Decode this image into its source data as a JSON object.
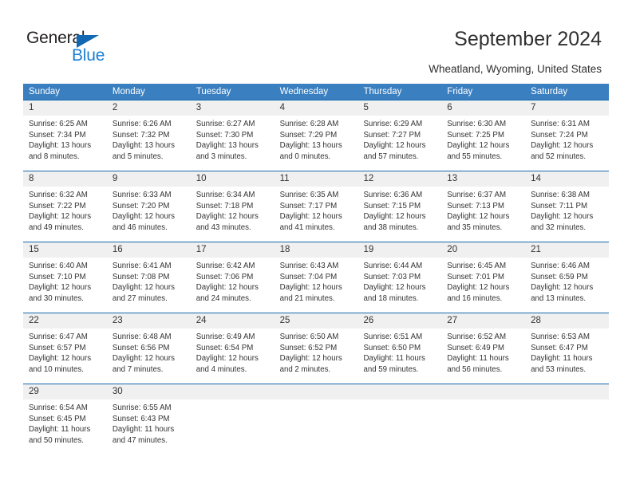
{
  "logo": {
    "primary_text": "General",
    "secondary_text": "Blue",
    "flag_icon": "blue-triangle-flag",
    "primary_color": "#231f20",
    "secondary_color": "#1a7fd4"
  },
  "header": {
    "title": "September 2024",
    "subtitle": "Wheatland, Wyoming, United States"
  },
  "theme": {
    "header_bar_color": "#3a7fc0",
    "cell_top_border_color": "#1668ae",
    "daynum_band_color": "#f0f0f0",
    "text_color": "#333333"
  },
  "calendar": {
    "weekdays": [
      "Sunday",
      "Monday",
      "Tuesday",
      "Wednesday",
      "Thursday",
      "Friday",
      "Saturday"
    ],
    "weeks": [
      [
        {
          "day": "1",
          "sunrise": "Sunrise: 6:25 AM",
          "sunset": "Sunset: 7:34 PM",
          "daylight": "Daylight: 13 hours and 8 minutes."
        },
        {
          "day": "2",
          "sunrise": "Sunrise: 6:26 AM",
          "sunset": "Sunset: 7:32 PM",
          "daylight": "Daylight: 13 hours and 5 minutes."
        },
        {
          "day": "3",
          "sunrise": "Sunrise: 6:27 AM",
          "sunset": "Sunset: 7:30 PM",
          "daylight": "Daylight: 13 hours and 3 minutes."
        },
        {
          "day": "4",
          "sunrise": "Sunrise: 6:28 AM",
          "sunset": "Sunset: 7:29 PM",
          "daylight": "Daylight: 13 hours and 0 minutes."
        },
        {
          "day": "5",
          "sunrise": "Sunrise: 6:29 AM",
          "sunset": "Sunset: 7:27 PM",
          "daylight": "Daylight: 12 hours and 57 minutes."
        },
        {
          "day": "6",
          "sunrise": "Sunrise: 6:30 AM",
          "sunset": "Sunset: 7:25 PM",
          "daylight": "Daylight: 12 hours and 55 minutes."
        },
        {
          "day": "7",
          "sunrise": "Sunrise: 6:31 AM",
          "sunset": "Sunset: 7:24 PM",
          "daylight": "Daylight: 12 hours and 52 minutes."
        }
      ],
      [
        {
          "day": "8",
          "sunrise": "Sunrise: 6:32 AM",
          "sunset": "Sunset: 7:22 PM",
          "daylight": "Daylight: 12 hours and 49 minutes."
        },
        {
          "day": "9",
          "sunrise": "Sunrise: 6:33 AM",
          "sunset": "Sunset: 7:20 PM",
          "daylight": "Daylight: 12 hours and 46 minutes."
        },
        {
          "day": "10",
          "sunrise": "Sunrise: 6:34 AM",
          "sunset": "Sunset: 7:18 PM",
          "daylight": "Daylight: 12 hours and 43 minutes."
        },
        {
          "day": "11",
          "sunrise": "Sunrise: 6:35 AM",
          "sunset": "Sunset: 7:17 PM",
          "daylight": "Daylight: 12 hours and 41 minutes."
        },
        {
          "day": "12",
          "sunrise": "Sunrise: 6:36 AM",
          "sunset": "Sunset: 7:15 PM",
          "daylight": "Daylight: 12 hours and 38 minutes."
        },
        {
          "day": "13",
          "sunrise": "Sunrise: 6:37 AM",
          "sunset": "Sunset: 7:13 PM",
          "daylight": "Daylight: 12 hours and 35 minutes."
        },
        {
          "day": "14",
          "sunrise": "Sunrise: 6:38 AM",
          "sunset": "Sunset: 7:11 PM",
          "daylight": "Daylight: 12 hours and 32 minutes."
        }
      ],
      [
        {
          "day": "15",
          "sunrise": "Sunrise: 6:40 AM",
          "sunset": "Sunset: 7:10 PM",
          "daylight": "Daylight: 12 hours and 30 minutes."
        },
        {
          "day": "16",
          "sunrise": "Sunrise: 6:41 AM",
          "sunset": "Sunset: 7:08 PM",
          "daylight": "Daylight: 12 hours and 27 minutes."
        },
        {
          "day": "17",
          "sunrise": "Sunrise: 6:42 AM",
          "sunset": "Sunset: 7:06 PM",
          "daylight": "Daylight: 12 hours and 24 minutes."
        },
        {
          "day": "18",
          "sunrise": "Sunrise: 6:43 AM",
          "sunset": "Sunset: 7:04 PM",
          "daylight": "Daylight: 12 hours and 21 minutes."
        },
        {
          "day": "19",
          "sunrise": "Sunrise: 6:44 AM",
          "sunset": "Sunset: 7:03 PM",
          "daylight": "Daylight: 12 hours and 18 minutes."
        },
        {
          "day": "20",
          "sunrise": "Sunrise: 6:45 AM",
          "sunset": "Sunset: 7:01 PM",
          "daylight": "Daylight: 12 hours and 16 minutes."
        },
        {
          "day": "21",
          "sunrise": "Sunrise: 6:46 AM",
          "sunset": "Sunset: 6:59 PM",
          "daylight": "Daylight: 12 hours and 13 minutes."
        }
      ],
      [
        {
          "day": "22",
          "sunrise": "Sunrise: 6:47 AM",
          "sunset": "Sunset: 6:57 PM",
          "daylight": "Daylight: 12 hours and 10 minutes."
        },
        {
          "day": "23",
          "sunrise": "Sunrise: 6:48 AM",
          "sunset": "Sunset: 6:56 PM",
          "daylight": "Daylight: 12 hours and 7 minutes."
        },
        {
          "day": "24",
          "sunrise": "Sunrise: 6:49 AM",
          "sunset": "Sunset: 6:54 PM",
          "daylight": "Daylight: 12 hours and 4 minutes."
        },
        {
          "day": "25",
          "sunrise": "Sunrise: 6:50 AM",
          "sunset": "Sunset: 6:52 PM",
          "daylight": "Daylight: 12 hours and 2 minutes."
        },
        {
          "day": "26",
          "sunrise": "Sunrise: 6:51 AM",
          "sunset": "Sunset: 6:50 PM",
          "daylight": "Daylight: 11 hours and 59 minutes."
        },
        {
          "day": "27",
          "sunrise": "Sunrise: 6:52 AM",
          "sunset": "Sunset: 6:49 PM",
          "daylight": "Daylight: 11 hours and 56 minutes."
        },
        {
          "day": "28",
          "sunrise": "Sunrise: 6:53 AM",
          "sunset": "Sunset: 6:47 PM",
          "daylight": "Daylight: 11 hours and 53 minutes."
        }
      ],
      [
        {
          "day": "29",
          "sunrise": "Sunrise: 6:54 AM",
          "sunset": "Sunset: 6:45 PM",
          "daylight": "Daylight: 11 hours and 50 minutes."
        },
        {
          "day": "30",
          "sunrise": "Sunrise: 6:55 AM",
          "sunset": "Sunset: 6:43 PM",
          "daylight": "Daylight: 11 hours and 47 minutes."
        },
        {
          "day": "",
          "sunrise": "",
          "sunset": "",
          "daylight": ""
        },
        {
          "day": "",
          "sunrise": "",
          "sunset": "",
          "daylight": ""
        },
        {
          "day": "",
          "sunrise": "",
          "sunset": "",
          "daylight": ""
        },
        {
          "day": "",
          "sunrise": "",
          "sunset": "",
          "daylight": ""
        },
        {
          "day": "",
          "sunrise": "",
          "sunset": "",
          "daylight": ""
        }
      ]
    ]
  }
}
